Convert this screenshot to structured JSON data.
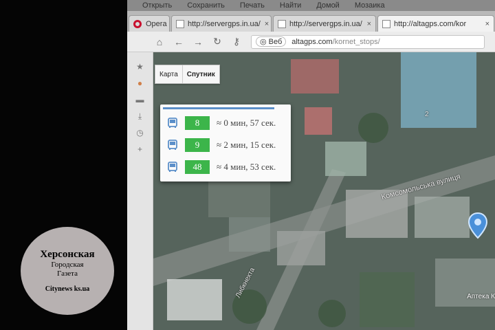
{
  "menu": {
    "items": [
      "Открыть",
      "Сохранить",
      "Печать",
      "Найти",
      "Домой",
      "Мозаика"
    ]
  },
  "tabs": [
    {
      "label": "Opera",
      "active": false
    },
    {
      "label": "http://servergps.in.ua/",
      "active": false
    },
    {
      "label": "http://servergps.in.ua/",
      "active": false
    },
    {
      "label": "http://altagps.com/kor",
      "active": true
    }
  ],
  "address": {
    "badge": "Веб",
    "host": "altagps.com",
    "path": "/kornet_stops/"
  },
  "map_controls": {
    "map_label": "Карта",
    "satellite_label": "Спутник"
  },
  "routes": [
    {
      "number": "8",
      "eta": "≈ 0 мин, 57 сек."
    },
    {
      "number": "9",
      "eta": "≈ 2 мин, 15 сек."
    },
    {
      "number": "48",
      "eta": "≈ 4 мин, 53 сек."
    }
  ],
  "map_labels": {
    "street_main": "Комсомольська вулиця",
    "street_side": "Либкнехта",
    "pharmacy": "Аптека К",
    "building_number": "2"
  },
  "watermark": {
    "line1": "Херсонская",
    "line2": "Городская",
    "line3": "Газета",
    "site": "Citynews ks.ua"
  },
  "colors": {
    "route_badge": "#3cb54a",
    "bus_icon": "#5b8fc9",
    "popup_bar": "#5b8fc9",
    "opera_red": "#c8102e",
    "pin": "#4a90d9"
  }
}
